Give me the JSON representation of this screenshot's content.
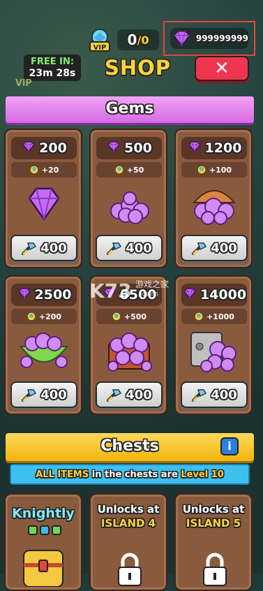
{
  "header": {
    "vip_label": "VIP",
    "vip_count": "0",
    "vip_max": "/0",
    "gem_balance": "999999999",
    "free_in_label": "FREE IN:",
    "free_in_time": "23m 28s",
    "title": "SHOP",
    "close_label": "✕",
    "vip_small": "ViP"
  },
  "gems_section": {
    "title": "Gems",
    "cards": [
      {
        "amount": "200",
        "bonus": "+20",
        "price": "400",
        "pic": "gem-single"
      },
      {
        "amount": "500",
        "bonus": "+50",
        "price": "400",
        "pic": "gem-pile"
      },
      {
        "amount": "1200",
        "bonus": "+100",
        "price": "400",
        "pic": "gem-bag"
      },
      {
        "amount": "2500",
        "bonus": "+200",
        "price": "400",
        "pic": "gem-bowl"
      },
      {
        "amount": "6500",
        "bonus": "+500",
        "price": "400",
        "pic": "gem-chest"
      },
      {
        "amount": "14000",
        "bonus": "+1000",
        "price": "400",
        "pic": "gem-vault"
      }
    ]
  },
  "chests_section": {
    "title": "Chests",
    "info_label": "i",
    "level_text_1": "ALL ITEMS",
    "level_text_2": " in the chests are ",
    "level_text_3": "Level 10",
    "cards": [
      {
        "name": "Knightly"
      },
      {
        "unlock_line1": "Unlocks at",
        "unlock_line2": "ISLAND 4"
      },
      {
        "unlock_line1": "Unlocks at",
        "unlock_line2": "ISLAND 5"
      }
    ]
  },
  "watermark": {
    "text1": "K73",
    "text2": "游戏之家",
    "text3": ".com"
  },
  "colors": {
    "gem": "#c46cf2",
    "close": "#f0364e",
    "banner_gems": "#e07ee9",
    "banner_chests": "#f5c21e",
    "level_bar": "#3ec0ef"
  }
}
